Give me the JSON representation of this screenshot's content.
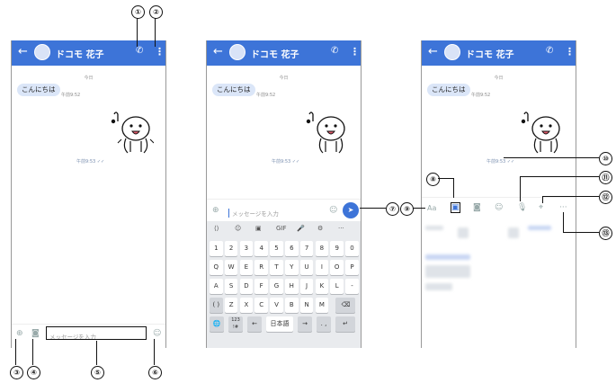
{
  "header": {
    "back_icon": "←",
    "contact_name": "ドコモ 花子",
    "call_icon": "phone-icon",
    "more_icon": "⋮"
  },
  "chat": {
    "date_label": "今日",
    "incoming_message": "こんにちは",
    "incoming_time": "午前9:52",
    "sticker_time": "午前9:53"
  },
  "input": {
    "placeholder": "メッセージを入力"
  },
  "keyboard": {
    "suggestions": [
      "⟨⟩",
      "☺",
      "▣",
      "GIF",
      "🎤",
      "⚙",
      "···"
    ],
    "row_numbers": [
      "1",
      "2",
      "3",
      "4",
      "5",
      "6",
      "7",
      "8",
      "9",
      "0"
    ],
    "row_q": [
      "Q",
      "W",
      "E",
      "R",
      "T",
      "Y",
      "U",
      "I",
      "O",
      "P"
    ],
    "row_a": [
      "A",
      "S",
      "D",
      "F",
      "G",
      "H",
      "J",
      "K",
      "L",
      "-"
    ],
    "row_z": [
      "( )",
      "Z",
      "X",
      "C",
      "V",
      "B",
      "N",
      "M",
      "⌫"
    ],
    "row_bottom": [
      "🌐",
      "123\n!#",
      "←",
      "日本語",
      "→",
      ". ,",
      "↵"
    ]
  },
  "panel3": {
    "aa_label": "Aa"
  },
  "callouts": {
    "c1": "①",
    "c2": "②",
    "c3": "③",
    "c4": "④",
    "c5": "⑤",
    "c6": "⑥",
    "c7": "⑦",
    "c8": "⑧",
    "c9": "⑨",
    "c10": "⑩",
    "c11": "⑪",
    "c12": "⑫",
    "c13": "⑬"
  },
  "colors": {
    "header_blue": "#3d74d8",
    "bubble": "#dbe6f8",
    "keyboard_bg": "#e9ebee"
  }
}
